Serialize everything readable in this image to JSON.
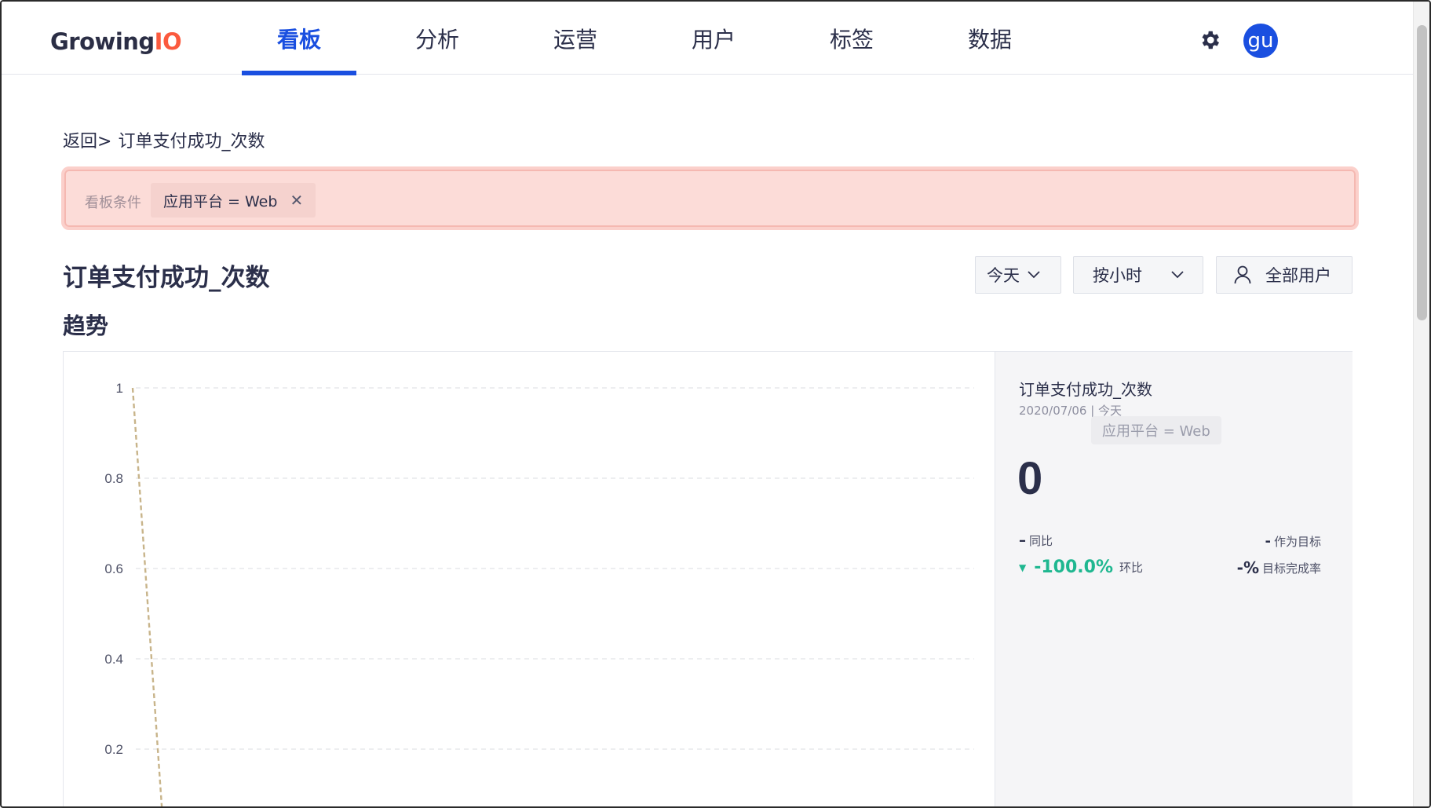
{
  "header": {
    "logo_text": "Growing",
    "logo_io": "IO",
    "nav": [
      {
        "label": "看板",
        "active": true
      },
      {
        "label": "分析",
        "active": false
      },
      {
        "label": "运营",
        "active": false
      },
      {
        "label": "用户",
        "active": false
      },
      {
        "label": "标签",
        "active": false
      },
      {
        "label": "数据",
        "active": false
      }
    ],
    "avatar_text": "gu",
    "settings_icon": "gear-icon"
  },
  "breadcrumb": {
    "back": "返回>",
    "current": "订单支付成功_次数"
  },
  "filter_bar": {
    "label": "看板条件",
    "chip": "应用平台 = Web",
    "close_icon": "close-icon"
  },
  "title": "订单支付成功_次数",
  "controls": {
    "date": "今天",
    "interval": "按小时",
    "users": "全部用户"
  },
  "section_title": "趋势",
  "chart_data": {
    "type": "line",
    "y_ticks": [
      "1",
      "0.8",
      "0.6",
      "0.4",
      "0.2"
    ],
    "ylim": [
      0,
      1
    ],
    "grid": true,
    "series": [
      {
        "values": [
          1,
          0
        ],
        "color": "#c8b48a",
        "dashed": true
      }
    ]
  },
  "summary": {
    "title": "订单支付成功_次数",
    "date": "2020/07/06 | 今天",
    "filter_chip": "应用平台 = Web",
    "value": "0",
    "yoy_dash": "–",
    "yoy_label": "同比",
    "target_dash": "-",
    "target_label": "作为目标",
    "mom_pct": "-100.0%",
    "mom_label": "环比",
    "rate_dash": "-%",
    "rate_label": "目标完成率"
  },
  "colors": {
    "accent": "#1a4fe0",
    "logo_io": "#fb5a3e",
    "filter_bg": "#fcdcd8",
    "positive": "#1fb790",
    "line": "#c8b48a"
  }
}
